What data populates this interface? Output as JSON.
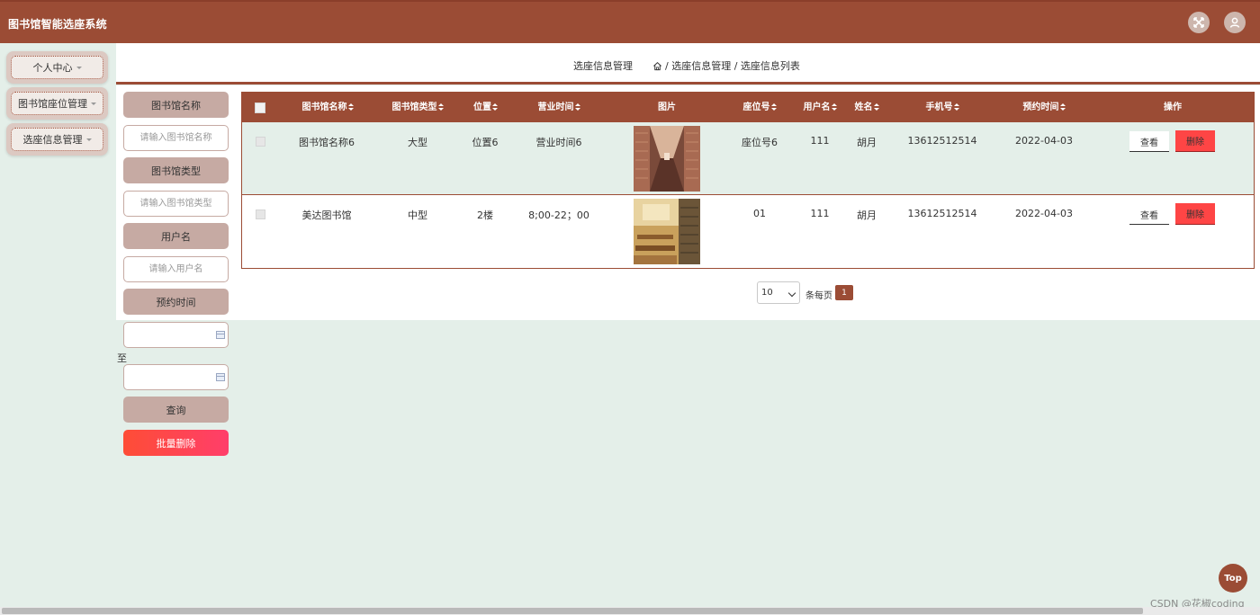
{
  "app": {
    "title": "图书馆智能选座系统"
  },
  "header": {
    "fullscreen_icon": "fullscreen-icon",
    "user_icon": "user-avatar-icon"
  },
  "sidebar": {
    "items": [
      {
        "label": "个人中心"
      },
      {
        "label": "图书馆座位管理"
      },
      {
        "label": "选座信息管理"
      }
    ]
  },
  "breadcrumb": {
    "title": "选座信息管理",
    "home_icon": "home-icon",
    "path": "/ 选座信息管理 / 选座信息列表"
  },
  "search": {
    "library_name_label": "图书馆名称",
    "library_name_placeholder": "请输入图书馆名称",
    "library_type_label": "图书馆类型",
    "library_type_placeholder": "请输入图书馆类型",
    "username_label": "用户名",
    "username_placeholder": "请输入用户名",
    "reserve_time_label": "预约时间",
    "to_label": "至",
    "query_label": "查询",
    "batch_delete_label": "批量删除"
  },
  "table": {
    "columns": [
      "图书馆名称",
      "图书馆类型",
      "位置",
      "营业时间",
      "图片",
      "座位号",
      "用户名",
      "姓名",
      "手机号",
      "预约时间",
      "操作"
    ],
    "rows": [
      {
        "library_name": "图书馆名称6",
        "library_type": "大型",
        "location": "位置6",
        "hours": "营业时间6",
        "seat_no": "座位号6",
        "username": "111",
        "name": "胡月",
        "phone": "13612512514",
        "reserve_time": "2022-04-03",
        "view_label": "查看",
        "delete_label": "删除"
      },
      {
        "library_name": "美达图书馆",
        "library_type": "中型",
        "location": "2楼",
        "hours": "8;00-22；00",
        "seat_no": "01",
        "username": "111",
        "name": "胡月",
        "phone": "13612512514",
        "reserve_time": "2022-04-03",
        "view_label": "查看",
        "delete_label": "删除"
      }
    ]
  },
  "pagination": {
    "page_size": "10",
    "per_page_label": "条每页",
    "current_page": "1"
  },
  "back_to_top": "Top",
  "watermark": "CSDN @花椒coding",
  "colors": {
    "primary": "#9b4c35",
    "background": "#e4efe9",
    "danger": "#fe4545"
  }
}
